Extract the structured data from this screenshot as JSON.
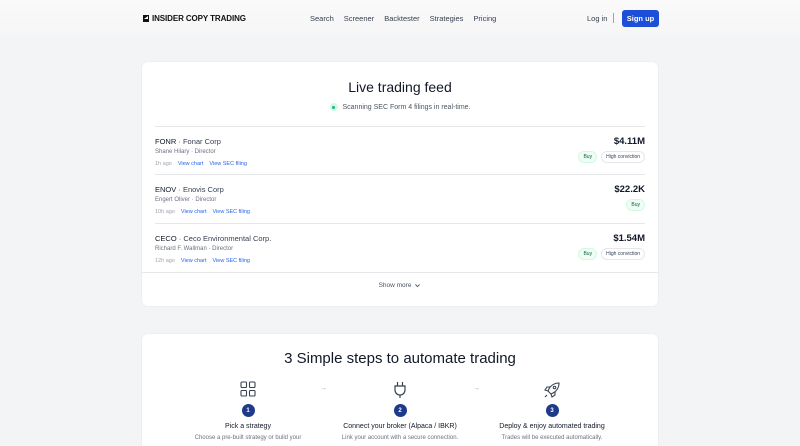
{
  "nav": {
    "brand": "INSIDER COPY TRADING",
    "links": [
      "Search",
      "Screener",
      "Backtester",
      "Strategies",
      "Pricing"
    ],
    "login": "Log in",
    "signup": "Sign up",
    "accent": "#1d4ed8"
  },
  "feed": {
    "title": "Live trading feed",
    "status": "Scanning SEC Form 4 filings in real-time.",
    "rows": [
      {
        "ticker": "FONR",
        "company": "Fonar Corp",
        "insider": "Shane Hilary · Director",
        "age": "1h ago",
        "chart_link": "View chart",
        "filing_link": "View SEC filing",
        "amount": "$4.11M",
        "badges": [
          "Buy",
          "High conviction"
        ]
      },
      {
        "ticker": "ENOV",
        "company": "Enovis Corp",
        "insider": "Engert Oliver · Director",
        "age": "10h ago",
        "chart_link": "View chart",
        "filing_link": "View SEC filing",
        "amount": "$22.2K",
        "badges": [
          "Buy"
        ]
      },
      {
        "ticker": "CECO",
        "company": "Ceco Environmental Corp.",
        "insider": "Richard F. Wallman · Director",
        "age": "12h ago",
        "chart_link": "View chart",
        "filing_link": "View SEC filing",
        "amount": "$1.54M",
        "badges": [
          "Buy",
          "High conviction"
        ]
      }
    ],
    "show_more": "Show more"
  },
  "steps": {
    "title": "3 Simple steps to automate trading",
    "items": [
      {
        "num": "1",
        "icon": "grid-icon",
        "title": "Pick a strategy",
        "desc": "Choose a pre-built strategy or build your"
      },
      {
        "num": "2",
        "icon": "plug-icon",
        "title": "Connect your broker (Alpaca / IBKR)",
        "desc": "Link your account with a secure connection."
      },
      {
        "num": "3",
        "icon": "rocket-icon",
        "title": "Deploy & enjoy automated trading",
        "desc": "Trades will be executed automatically."
      }
    ]
  }
}
